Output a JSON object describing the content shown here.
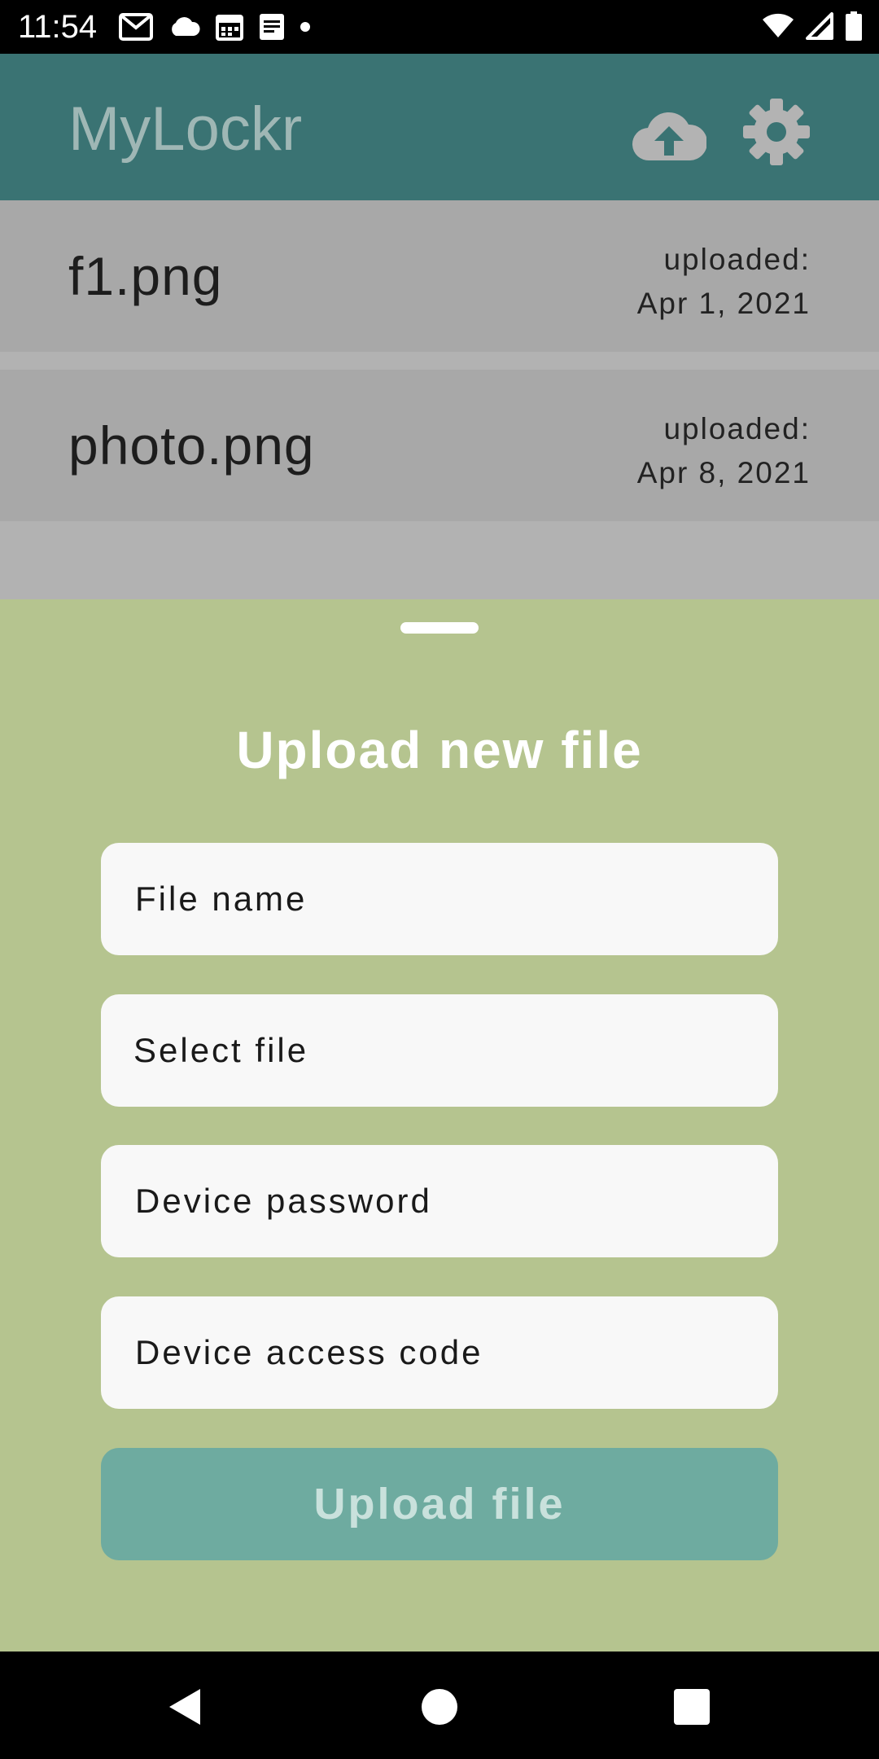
{
  "status_bar": {
    "time": "11:54",
    "left_icons": [
      "gmail-icon",
      "cloud-icon",
      "calendar-icon",
      "notes-icon",
      "dot-icon"
    ],
    "right_icons": [
      "wifi-icon",
      "signal-icon",
      "battery-icon"
    ]
  },
  "app_bar": {
    "title": "MyLockr",
    "actions": [
      "cloud-upload-icon",
      "gear-icon"
    ]
  },
  "files": [
    {
      "name": "f1.png",
      "uploaded_label": "uploaded:",
      "date": "Apr 1, 2021"
    },
    {
      "name": "photo.png",
      "uploaded_label": "uploaded:",
      "date": "Apr 8, 2021"
    }
  ],
  "upload_sheet": {
    "title": "Upload new file",
    "file_name_placeholder": "File name",
    "select_file_label": "Select file",
    "device_password_placeholder": "Device password",
    "device_access_code_placeholder": "Device access code",
    "submit_label": "Upload file"
  },
  "colors": {
    "app_bar": "#3a7373",
    "sheet": "#b5c48f",
    "button": "#6eaba0"
  }
}
